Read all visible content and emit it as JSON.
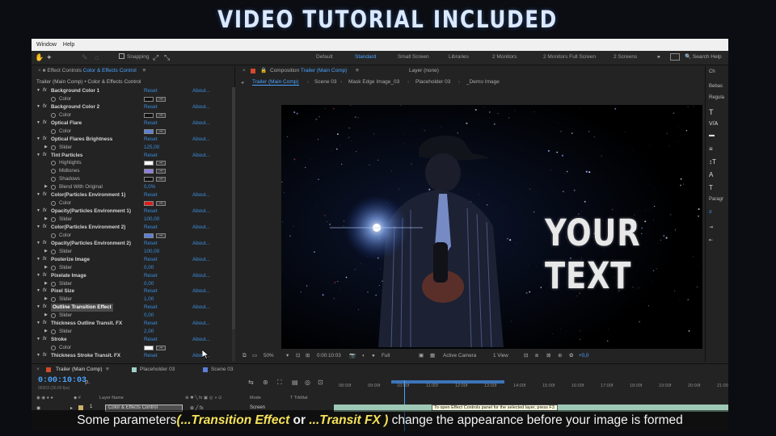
{
  "banner": {
    "title": "VIDEO TUTORIAL INCLUDED"
  },
  "menubar": {
    "items": [
      "Window",
      "Help"
    ]
  },
  "toolbar": {
    "snapping": "Snapping",
    "workspaces": [
      "Default",
      "Standard",
      "Small Screen",
      "Libraries",
      "2 Monitors",
      "2 Monitors Full Screen",
      "2 Screens"
    ],
    "active_workspace": "Standard",
    "search": "Search Help"
  },
  "effect_controls": {
    "panel_label": "Effect Controls",
    "panel_target": "Color & Effects Control",
    "breadcrumb": "Trailer (Main Comp) • Color & Effects Control",
    "rows": [
      {
        "kind": "fx",
        "name": "Background Color 1",
        "reset": "Reset",
        "about": "About..."
      },
      {
        "kind": "prop",
        "name": "Color",
        "chip": "#111111"
      },
      {
        "kind": "fx",
        "name": "Background Color 2",
        "reset": "Reset",
        "about": "About..."
      },
      {
        "kind": "prop",
        "name": "Color",
        "chip": "#111111"
      },
      {
        "kind": "fx",
        "name": "Optical Flare",
        "reset": "Reset",
        "about": "About..."
      },
      {
        "kind": "prop",
        "name": "Color",
        "chip": "#5b7fd6"
      },
      {
        "kind": "fx",
        "name": "Optical Flares Brightness",
        "reset": "Reset",
        "about": "About..."
      },
      {
        "kind": "slider",
        "name": "Slider",
        "value": "125,00"
      },
      {
        "kind": "fx",
        "name": "Tint Particles",
        "reset": "Reset",
        "about": "About..."
      },
      {
        "kind": "prop",
        "name": "Highlights",
        "chip": "#ffffff"
      },
      {
        "kind": "prop",
        "name": "Midtones",
        "chip": "#8d7fe0"
      },
      {
        "kind": "prop",
        "name": "Shadows",
        "chip": "#111111"
      },
      {
        "kind": "slider",
        "name": "Blend With Original",
        "value": "0,0%"
      },
      {
        "kind": "fx",
        "name": "Color(Particles Environment 1)",
        "reset": "Reset",
        "about": "About..."
      },
      {
        "kind": "prop",
        "name": "Color",
        "chip": "#e01a1a"
      },
      {
        "kind": "fx",
        "name": "Opacity(Particles Environment 1)",
        "reset": "Reset",
        "about": "About..."
      },
      {
        "kind": "slider",
        "name": "Slider",
        "value": "100,00"
      },
      {
        "kind": "fx",
        "name": "Color(Particles Environment 2)",
        "reset": "Reset",
        "about": "About..."
      },
      {
        "kind": "prop",
        "name": "Color",
        "chip": "#5b7fd6"
      },
      {
        "kind": "fx",
        "name": "Opacity(Particles Environment 2)",
        "reset": "Reset",
        "about": "About..."
      },
      {
        "kind": "slider",
        "name": "Slider",
        "value": "100,00"
      },
      {
        "kind": "fx",
        "name": "Posterize Image",
        "reset": "Reset",
        "about": "About..."
      },
      {
        "kind": "slider",
        "name": "Slider",
        "value": "0,00"
      },
      {
        "kind": "fx",
        "name": "Pixelate Image",
        "reset": "Reset",
        "about": "About..."
      },
      {
        "kind": "slider",
        "name": "Slider",
        "value": "0,00"
      },
      {
        "kind": "fx",
        "name": "Pixel Size",
        "reset": "Reset",
        "about": "About..."
      },
      {
        "kind": "slider",
        "name": "Slider",
        "value": "1,00"
      },
      {
        "kind": "fx",
        "name": "Outline Transition Effect",
        "reset": "Reset",
        "about": "About...",
        "highlight": true
      },
      {
        "kind": "slider",
        "name": "Slider",
        "value": "0,00"
      },
      {
        "kind": "fx",
        "name": "Thickness Outline Transit. FX",
        "reset": "Reset",
        "about": "About..."
      },
      {
        "kind": "slider",
        "name": "Slider",
        "value": "2,00"
      },
      {
        "kind": "fx",
        "name": "Stroke",
        "reset": "Reset",
        "about": "About..."
      },
      {
        "kind": "prop",
        "name": "Color",
        "chip": "#ffffff"
      },
      {
        "kind": "fx",
        "name": "Thickness Stroke Transit. FX",
        "reset": "Reset",
        "about": "About..."
      }
    ]
  },
  "composition": {
    "panel_label": "Composition",
    "panel_target": "Trailer (Main Comp)",
    "layer_label": "Layer (none)",
    "tabs": [
      "Trailer (Main Comp)",
      "Scene 03",
      "Mask Edge Image_03",
      "Placeholder 03",
      "_Demo Image"
    ],
    "overlay_text": "YOUR TEXT",
    "zoom": "50%",
    "timecode": "0:00:10:03",
    "resolution": "Full",
    "camera": "Active Camera",
    "views": "1 View",
    "exposure": "+0,0"
  },
  "right_panel": {
    "items": [
      "Ch",
      "Bebas",
      "Regula",
      "Paragr"
    ]
  },
  "timeline": {
    "tabs": [
      "Trailer (Main Comp)",
      "Placeholder 03",
      "Scene 03"
    ],
    "timecode": "0:00:10:03",
    "timecode_sub": "00303 (30.00 fps)",
    "ruler": [
      "08:00f",
      "09:00f",
      "10:00f",
      "11:00f",
      "12:00f",
      "13:00f",
      "14:00f",
      "15:00f",
      "16:00f",
      "17:00f",
      "18:00f",
      "19:00f",
      "20:00f",
      "21:00f"
    ],
    "columns": {
      "layer_name": "Layer Name",
      "mode": "Mode",
      "trkmat": "T TrkMat"
    },
    "layer": {
      "index": "1",
      "name": "Color & Effects Control",
      "mode": "Screen"
    },
    "tooltip": "To open Effect Controls panel for the selected layer, press F3."
  },
  "caption": {
    "lead": "Some parameters",
    "em1": "(...Transition Effect",
    "mid": " or ",
    "em2": "...Transit FX )",
    "tail": " change the appearance before your image is formed"
  }
}
